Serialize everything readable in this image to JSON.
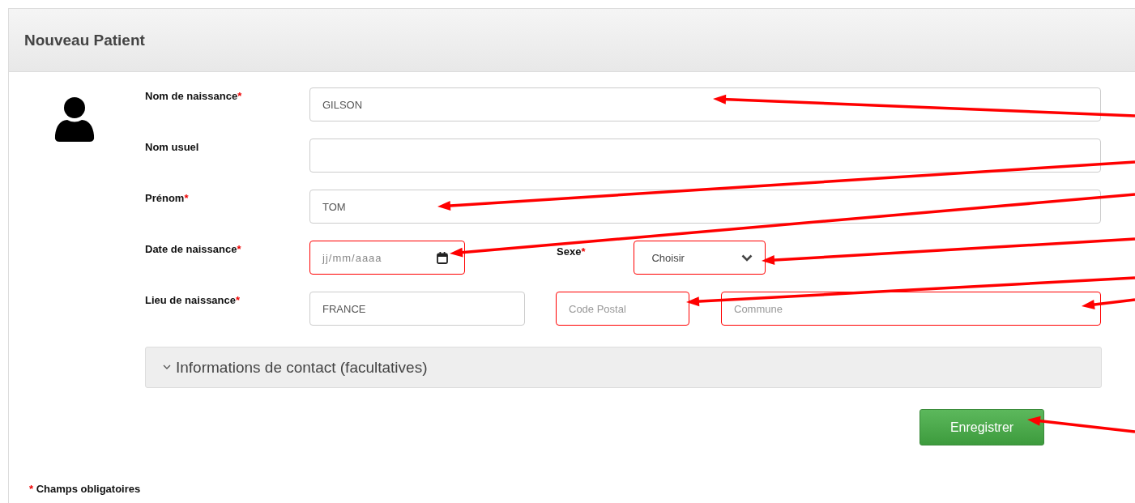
{
  "panel": {
    "title": "Nouveau Patient"
  },
  "fields": {
    "nom_naissance": {
      "label": "Nom de naissance",
      "required": true,
      "value": "GILSON",
      "invalid": false
    },
    "nom_usuel": {
      "label": "Nom usuel",
      "required": false,
      "invalid": false
    },
    "prenom": {
      "label": "Prénom",
      "required": true,
      "value": "TOM",
      "invalid": false
    },
    "date_naissance": {
      "label": "Date de naissance",
      "required": true,
      "placeholder": "jj/mm/aaaa",
      "invalid": true
    },
    "sexe": {
      "label": "Sexe",
      "required": true,
      "value": "Choisir",
      "invalid": true
    },
    "lieu_naissance": {
      "label": "Lieu de naissance",
      "required": true,
      "value": "FRANCE",
      "invalid": false
    },
    "code_postal": {
      "placeholder": "Code Postal",
      "invalid": true
    },
    "commune": {
      "placeholder": "Commune",
      "invalid": true
    }
  },
  "contact_section": {
    "label": "Informations de contact (facultatives)",
    "expanded": false
  },
  "save_button": "Enregistrer",
  "footnote": {
    "mark": "*",
    "text": "Champs obligatoires"
  }
}
